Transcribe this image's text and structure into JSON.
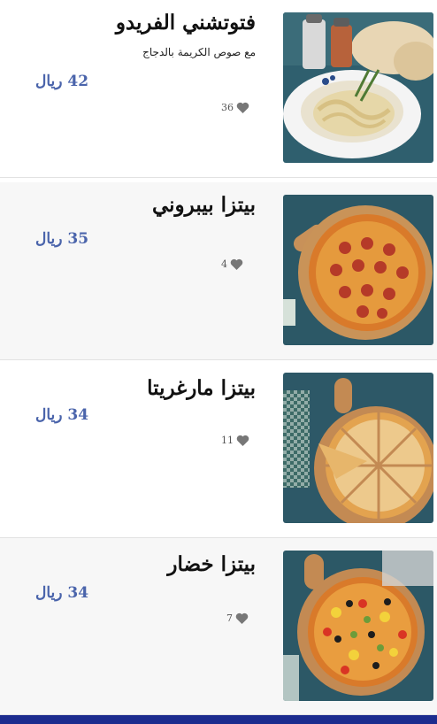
{
  "menu_items": [
    {
      "title": "فتوتشني الفريدو",
      "description": "مع صوص الكريمة بالدجاج",
      "price": "42 ريال",
      "likes": "36",
      "image_icon": "pasta-plate-image"
    },
    {
      "title": "بيتزا بيبروني",
      "price": "35 ريال",
      "likes": "4",
      "image_icon": "pepperoni-pizza-image"
    },
    {
      "title": "بيتزا مارغريتا",
      "price": "34 ريال",
      "likes": "11",
      "image_icon": "margherita-pizza-image"
    },
    {
      "title": "بيتزا خضار",
      "price": "34 ريال",
      "likes": "7",
      "image_icon": "vegetable-pizza-image"
    }
  ],
  "colors": {
    "price": "#4a64ab",
    "footer_bar": "#1c2c8e",
    "heart": "#777777",
    "thumbnail_background": "#2c5866"
  }
}
